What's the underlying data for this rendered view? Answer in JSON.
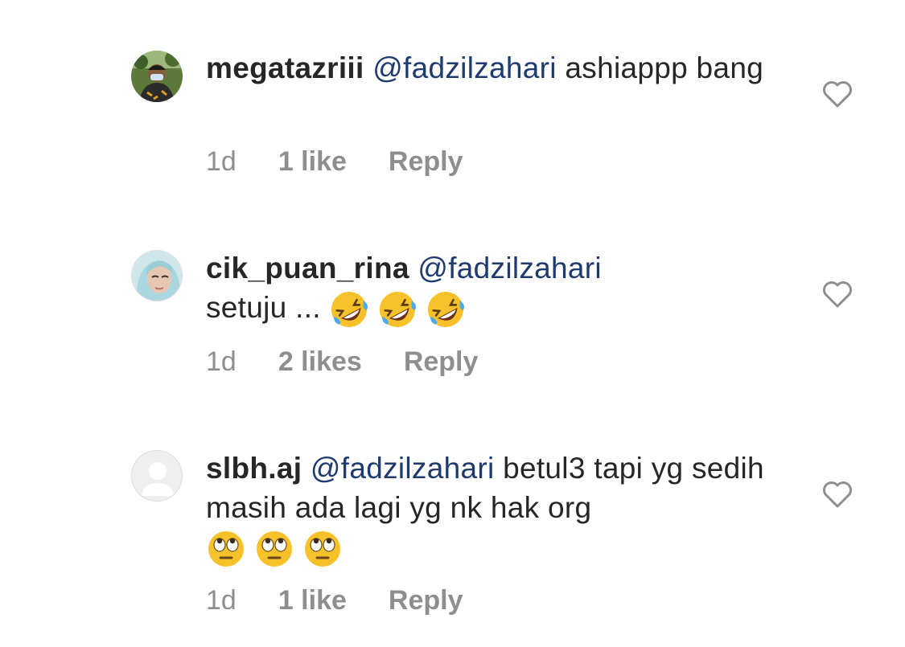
{
  "comments": [
    {
      "username": "megatazriii",
      "mention": "@fadzilzahari",
      "text": " ashiappp bang",
      "time": "1d",
      "likes": "1 like",
      "reply_label": "Reply",
      "avatar": "profile-photo"
    },
    {
      "username": "cik_puan_rina",
      "mention": "@fadzilzahari",
      "text": "setuju ...",
      "emojis": [
        "rofl-emoji",
        "rofl-emoji",
        "rofl-emoji"
      ],
      "time": "1d",
      "likes": "2 likes",
      "reply_label": "Reply",
      "avatar": "profile-photo"
    },
    {
      "username": "slbh.aj",
      "mention": "@fadzilzahari",
      "text": " betul3 tapi yg sedih masih ada lagi yg nk hak org",
      "emojis": [
        "eye-roll-emoji",
        "eye-roll-emoji",
        "eye-roll-emoji"
      ],
      "time": "1d",
      "likes": "1 like",
      "reply_label": "Reply",
      "avatar": "default-avatar"
    }
  ],
  "colors": {
    "text": "#262626",
    "mention": "#1e3a6e",
    "meta": "#8e8e8e",
    "heart_stroke": "#8e8e8e"
  },
  "icons": {
    "like": "heart-outline-icon"
  }
}
